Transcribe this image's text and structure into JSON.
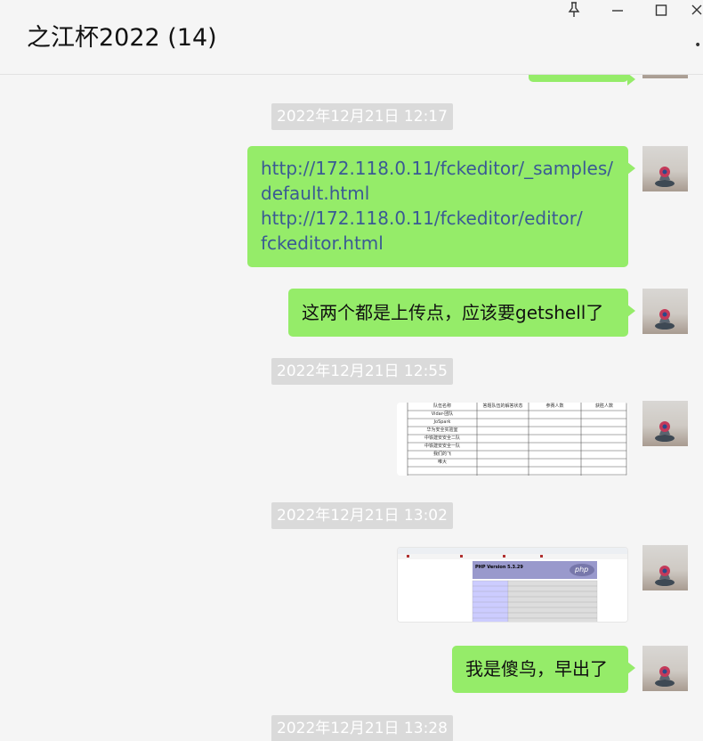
{
  "window": {
    "title": "之江杯2022 (14)",
    "controls": {
      "pin": "pin-icon",
      "minimize": "minimize-icon",
      "maximize": "maximize-icon",
      "close": "close-icon"
    },
    "more_label": "•"
  },
  "colors": {
    "background": "#f5f5f5",
    "bubble": "#95ec69",
    "timestamp_bg": "#dadada",
    "link": "#3a5a94"
  },
  "messages": {
    "t1": "2022年12月21日 12:17",
    "m1_line1": "http://172.118.0.11/fckeditor/_samples/",
    "m1_line2": "default.html",
    "m1_line3": "http://172.118.0.11/fckeditor/editor/",
    "m1_line4": "fckeditor.html",
    "m2": "这两个都是上传点，应该要getshell了",
    "t2": "2022年12月21日 12:55",
    "t3": "2022年12月21日 13:02",
    "m5": "我是傻鸟，早出了",
    "t4": "2022年12月21日 13:28"
  },
  "image1": {
    "headers": [
      "队伍名称",
      "答题队伍的解答状态",
      "参赛人数",
      "获胜人数"
    ],
    "rows": [
      "Vidar-团队",
      "JoSpark",
      "华为安全实验室",
      "中铁建安安全二队",
      "中铁建安安全一队",
      "我们的飞",
      "唯大"
    ]
  },
  "image2": {
    "banner": "PHP Version 5.3.29",
    "logo": "php"
  }
}
